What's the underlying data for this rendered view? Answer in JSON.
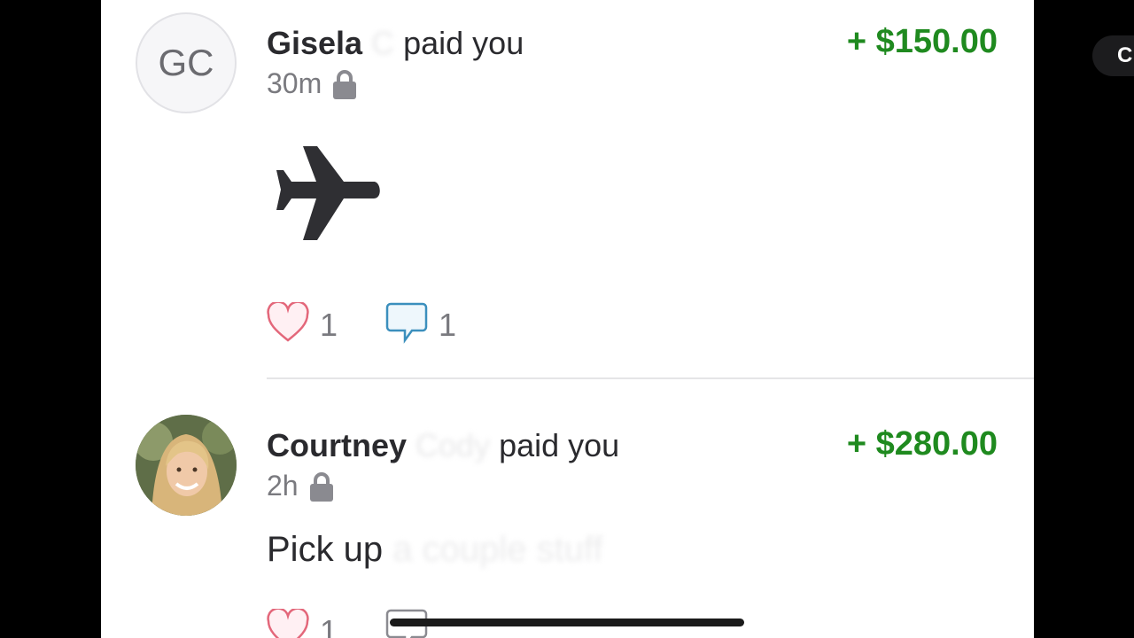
{
  "right_pill": {
    "text": "C"
  },
  "feed": [
    {
      "avatar_initials": "GC",
      "name": "Gisela",
      "name_hidden": "C",
      "action": "paid you",
      "amount": "+ $150.00",
      "time": "30m",
      "note_icon": "airplane-icon",
      "likes": "1",
      "comments": "1"
    },
    {
      "name": "Courtney",
      "name_hidden": "Cody",
      "action": "paid you",
      "amount": "+ $280.00",
      "time": "2h",
      "note_visible": "Pick up",
      "note_hidden": "a couple stuff",
      "likes": "1"
    }
  ],
  "colors": {
    "amount": "#1f8a1f",
    "heart": "#e3677a",
    "comment": "#3b8fbd"
  }
}
